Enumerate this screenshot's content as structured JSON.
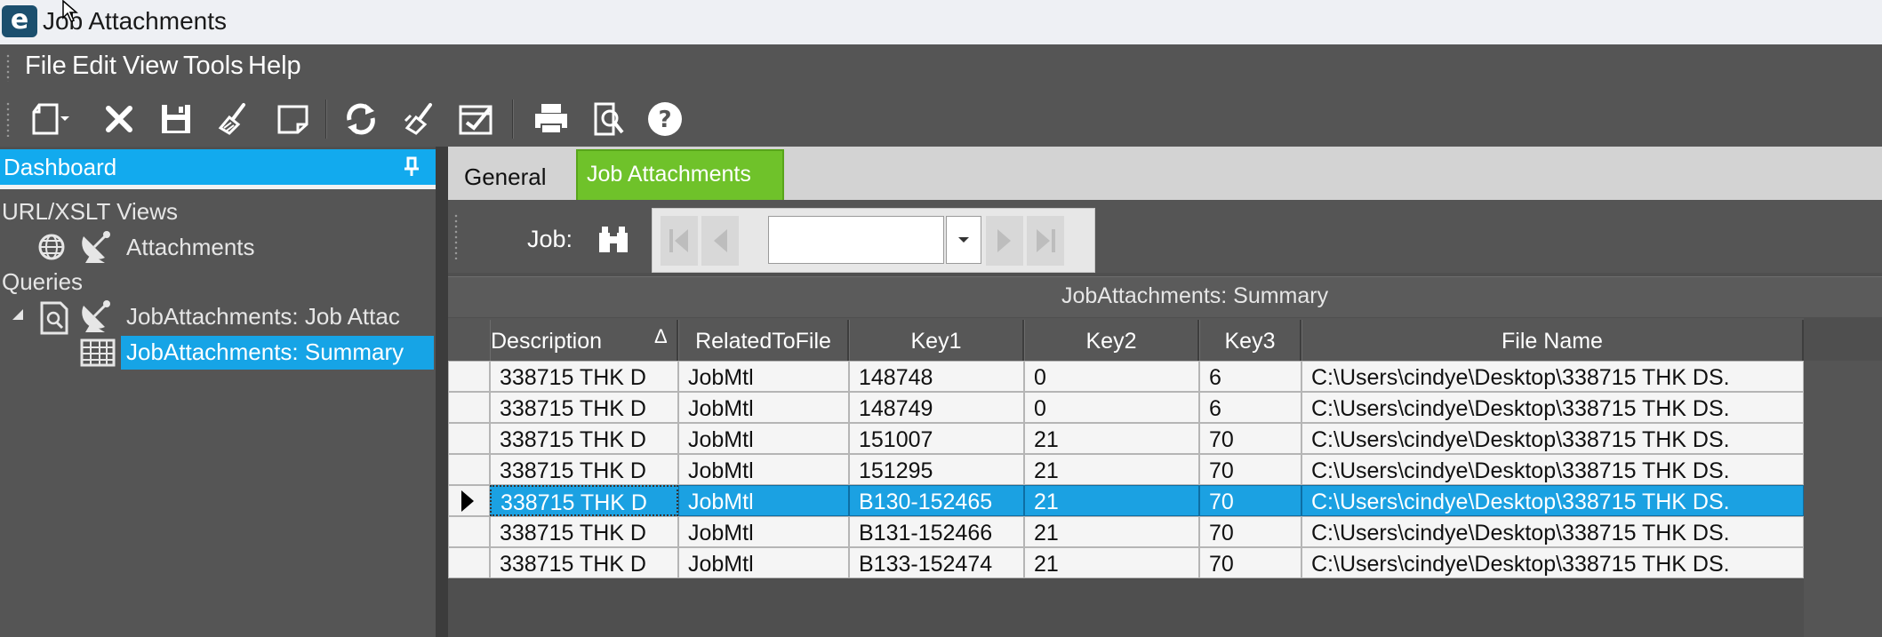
{
  "window": {
    "title": "Job Attachments",
    "logo_letter": "e"
  },
  "menu": {
    "items": [
      "File",
      "Edit",
      "View",
      "Tools",
      "Help"
    ]
  },
  "toolbar": {
    "icons": [
      "new-icon",
      "dropdown-arrow-icon",
      "delete-icon",
      "save-icon",
      "clear-icon",
      "note-icon",
      "refresh-icon",
      "clear-all-icon",
      "checklist-icon",
      "print-icon",
      "print-preview-icon",
      "help-icon"
    ]
  },
  "dashboard": {
    "title": "Dashboard",
    "tree": {
      "url_xslt_views": "URL/XSLT Views",
      "attachments": "Attachments",
      "queries": "Queries",
      "jobattachments_query": "JobAttachments: Job Attac",
      "summary_item": "JobAttachments: Summary"
    }
  },
  "tabs": {
    "general": "General",
    "job_attachments": "Job Attachments",
    "active": "Job Attachments"
  },
  "job": {
    "label": "Job:",
    "value": ""
  },
  "grid": {
    "title": "JobAttachments: Summary",
    "columns": [
      "Description",
      "RelatedToFile",
      "Key1",
      "Key2",
      "Key3",
      "File Name"
    ],
    "sort_indicator": "Δ",
    "rows": [
      [
        "338715 THK D",
        "JobMtl",
        "148748",
        "0",
        "6",
        "C:\\Users\\cindye\\Desktop\\338715 THK DS."
      ],
      [
        "338715 THK D",
        "JobMtl",
        "148749",
        "0",
        "6",
        "C:\\Users\\cindye\\Desktop\\338715 THK DS."
      ],
      [
        "338715 THK D",
        "JobMtl",
        "151007",
        "21",
        "70",
        "C:\\Users\\cindye\\Desktop\\338715 THK DS."
      ],
      [
        "338715 THK D",
        "JobMtl",
        "151295",
        "21",
        "70",
        "C:\\Users\\cindye\\Desktop\\338715 THK DS."
      ],
      [
        "338715 THK D",
        "JobMtl",
        "B130-152465",
        "21",
        "70",
        "C:\\Users\\cindye\\Desktop\\338715 THK DS."
      ],
      [
        "338715 THK D",
        "JobMtl",
        "B131-152466",
        "21",
        "70",
        "C:\\Users\\cindye\\Desktop\\338715 THK DS."
      ],
      [
        "338715 THK D",
        "JobMtl",
        "B133-152474",
        "21",
        "70",
        "C:\\Users\\cindye\\Desktop\\338715 THK DS."
      ]
    ],
    "selected_row": 4
  },
  "colors": {
    "accent_blue": "#16a4e6",
    "tab_green": "#6fc22a",
    "panel_gray": "#555555"
  }
}
